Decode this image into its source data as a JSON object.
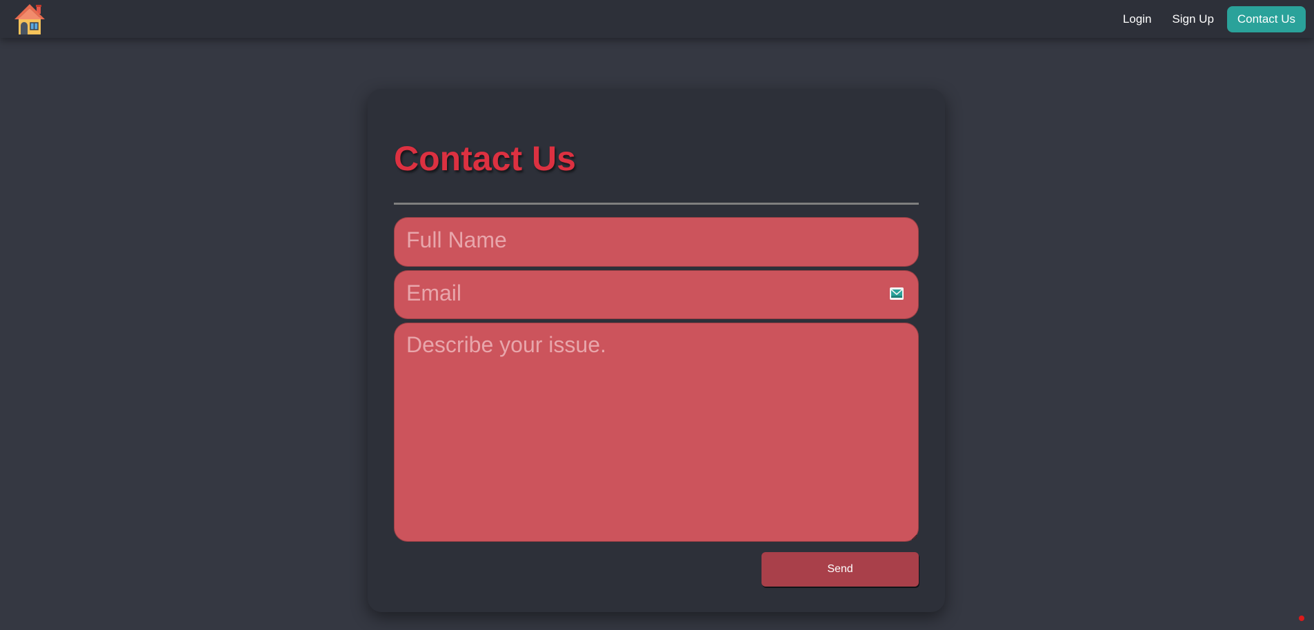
{
  "nav": {
    "logo_icon": "house-icon",
    "links": [
      {
        "label": "Login",
        "active": false
      },
      {
        "label": "Sign Up",
        "active": false
      },
      {
        "label": "Contact Us",
        "active": true
      }
    ],
    "accent_color": "#2aa29a"
  },
  "form": {
    "title": "Contact Us",
    "title_color": "#dc3141",
    "name_placeholder": "Full Name",
    "email_placeholder": "Email",
    "email_icon": "envelope-icon",
    "issue_placeholder": "Describe your issue.",
    "field_color": "#cc545c",
    "send_label": "Send",
    "send_color": "#a9404a"
  },
  "background_color": "#353842"
}
